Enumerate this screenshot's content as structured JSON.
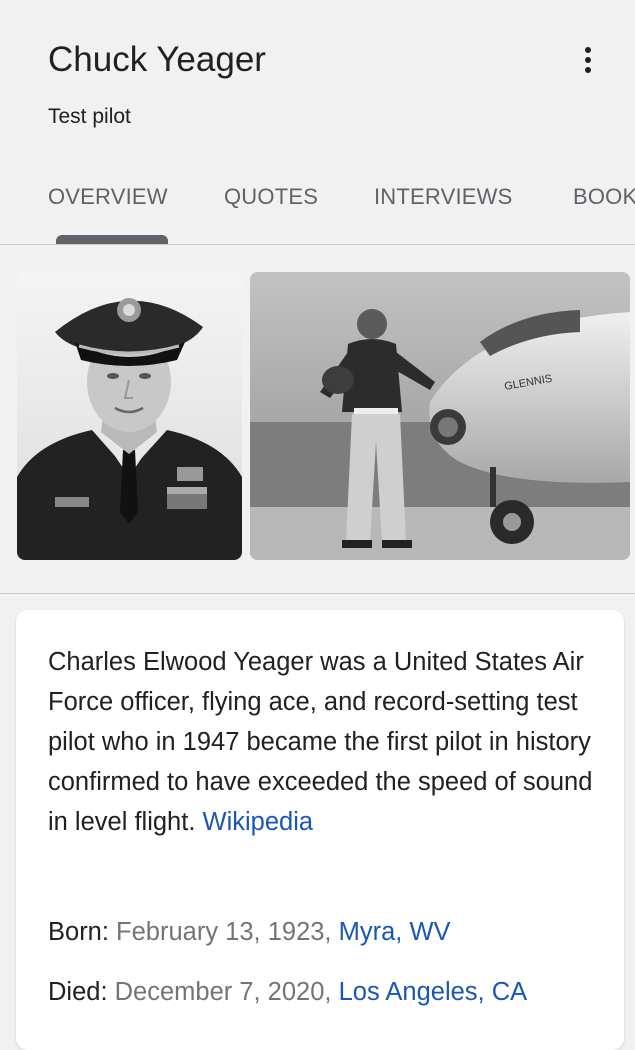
{
  "header": {
    "title": "Chuck Yeager",
    "subtitle": "Test pilot"
  },
  "tabs": [
    {
      "label": "OVERVIEW",
      "active": true
    },
    {
      "label": "QUOTES"
    },
    {
      "label": "INTERVIEWS"
    },
    {
      "label": "BOOK"
    }
  ],
  "images": {
    "plane_nose_text": "GLENNIS"
  },
  "knowledge_card": {
    "description": "Charles Elwood Yeager was a United States Air Force officer, flying ace, and record-setting test pilot who in 1947 became the first pilot in history confirmed to have exceeded the speed of sound in level flight.",
    "source_link": "Wikipedia",
    "born": {
      "label": "Born:",
      "date": "February 13, 1923,",
      "place": "Myra, WV"
    },
    "died": {
      "label": "Died:",
      "date": "December 7, 2020,",
      "place": "Los Angeles, CA"
    }
  },
  "colors": {
    "link": "#1a57b5",
    "background": "#f1f1f1",
    "tab_indicator": "#5f6368"
  },
  "icons": {
    "more": "more-vert-icon"
  }
}
